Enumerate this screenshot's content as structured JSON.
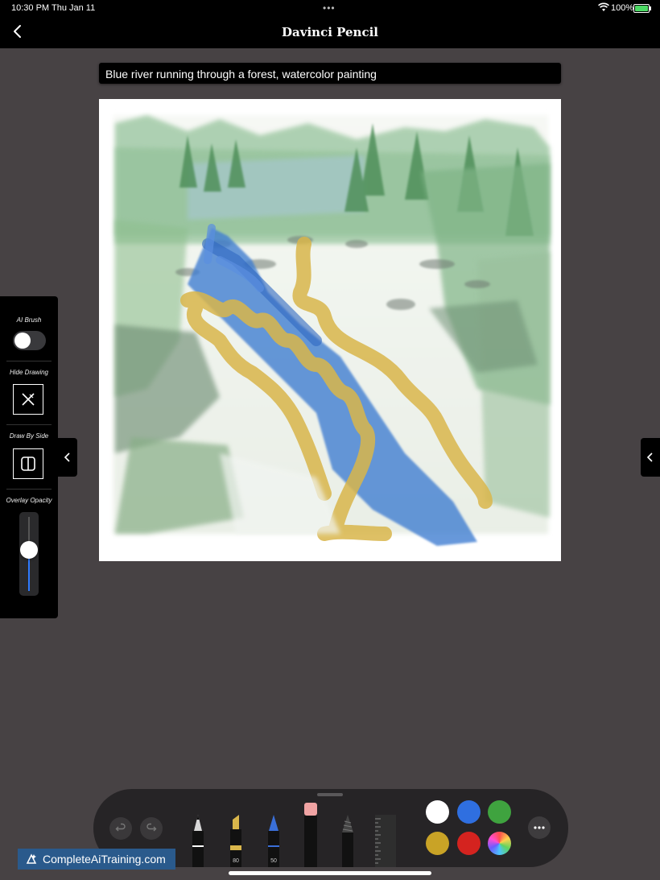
{
  "status_bar": {
    "time": "10:30 PM",
    "date": "Thu Jan 11",
    "battery": "100%"
  },
  "nav": {
    "title": "Davinci Pencil"
  },
  "prompt": {
    "value": "Blue river running through a forest, watercolor painting"
  },
  "left_panel": {
    "ai_brush_label": "AI Brush",
    "ai_brush_on": false,
    "hide_drawing_label": "Hide Drawing",
    "draw_by_side_label": "Draw By Side",
    "overlay_opacity_label": "Overlay Opacity",
    "overlay_opacity": 0.55
  },
  "toolbar": {
    "tools": [
      {
        "name": "pen"
      },
      {
        "name": "marker",
        "size": "80"
      },
      {
        "name": "pencil",
        "size": "50"
      },
      {
        "name": "eraser"
      },
      {
        "name": "lasso"
      },
      {
        "name": "ruler"
      }
    ],
    "colors": [
      "#ffffff",
      "#2f6fe0",
      "#3fa33f",
      "#c9a326",
      "#d4231f",
      "multicolor"
    ]
  },
  "watermark": {
    "text": "CompleteAiTraining.com"
  }
}
